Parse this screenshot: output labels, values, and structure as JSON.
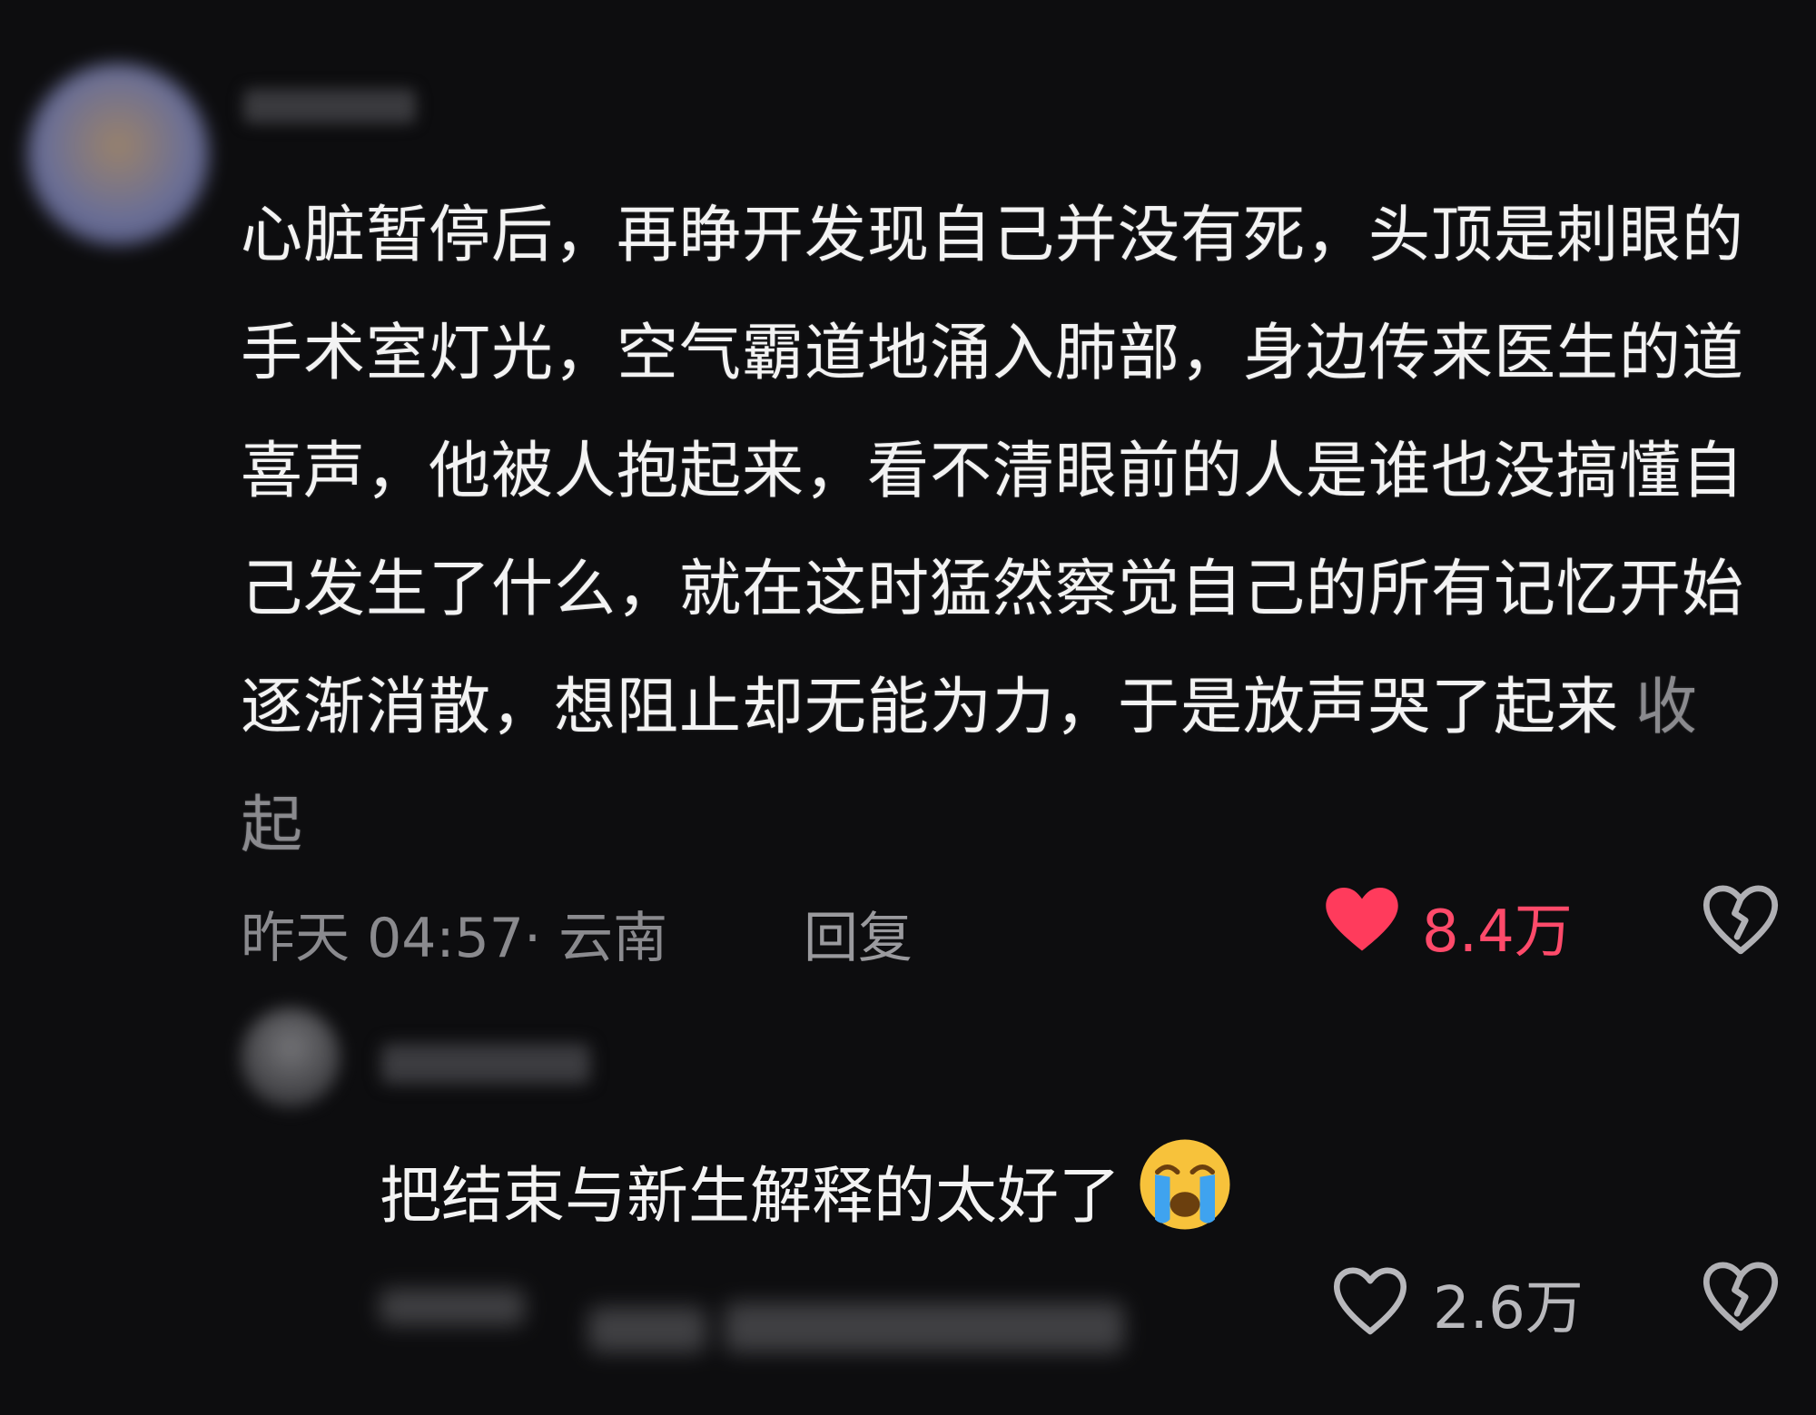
{
  "comment": {
    "text": "心脏暂停后，再睁开发现自己并没有死，头顶是刺眼的手术室灯光，空气霸道地涌入肺部，身边传来医生的道喜声，他被人抱起来，看不清眼前的人是谁也没搞懂自己发生了什么，就在这时猛然察觉自己的所有记忆开始逐渐消散，想阻止却无能为力，于是放声哭了起来",
    "collapse_label": "收起",
    "time_location": "昨天 04:57· 云南",
    "reply_label": "回复",
    "like_count": "8.4万",
    "liked": true
  },
  "reply": {
    "text": "把结束与新生解释的太好了",
    "emoji": "loudly-crying-face",
    "like_count": "2.6万",
    "liked": false
  },
  "colors": {
    "background": "#0d0d0f",
    "like_active": "#ff3b5c",
    "muted_text": "#8a8a8e"
  }
}
